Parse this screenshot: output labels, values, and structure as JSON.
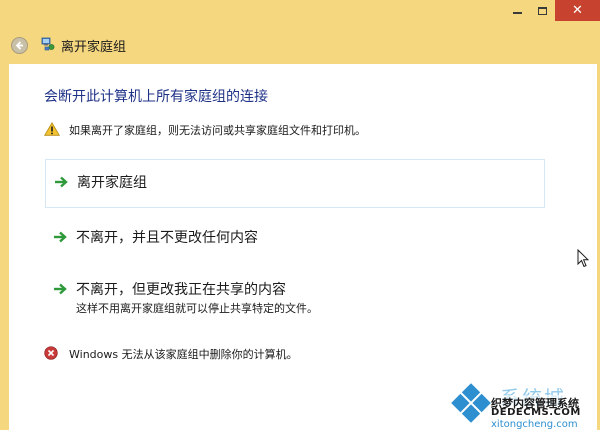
{
  "window": {
    "controls": {
      "minimize": "",
      "maximize": "",
      "close": "✕"
    }
  },
  "nav": {
    "title": "离开家庭组",
    "back_icon": "back-arrow-icon",
    "page_icon": "homegroup-icon"
  },
  "content": {
    "heading": "会断开此计算机上所有家庭组的连接",
    "warning": "如果离开了家庭组，则无法访问或共享家庭组文件和打印机。",
    "options": [
      {
        "label": "离开家庭组",
        "description": ""
      },
      {
        "label": "不离开，并且不更改任何内容",
        "description": ""
      },
      {
        "label": "不离开，但更改我正在共享的内容",
        "description": "这样不用离开家庭组就可以停止共享特定的文件。"
      }
    ],
    "error": "Windows 无法从该家庭组中删除你的计算机。"
  },
  "watermark": {
    "line1": "系统城",
    "line2": "织梦内容管理系统",
    "line3": "DEDECMS.COM",
    "line4": "xitongcheng.com"
  },
  "colors": {
    "frame": "#f5d780",
    "heading": "#1e3287",
    "close": "#c8432f",
    "arrow": "#2e9a3a",
    "option_border": "#d6e8f5",
    "error_icon": "#c83a3a",
    "warning_icon": "#f2c230"
  }
}
